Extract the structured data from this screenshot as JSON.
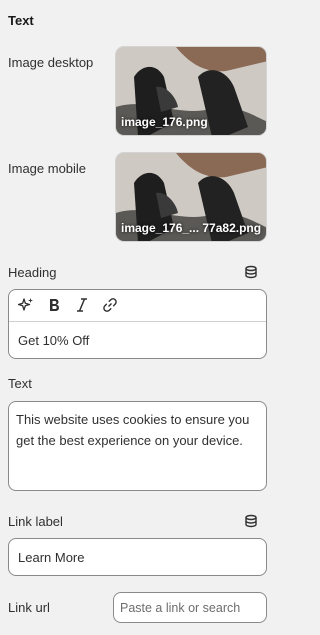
{
  "section": {
    "title": "Text"
  },
  "image_desktop": {
    "label": "Image desktop",
    "filename": "image_176.png"
  },
  "image_mobile": {
    "label": "Image mobile",
    "filename": "image_176_... 77a82.png"
  },
  "heading": {
    "label": "Heading",
    "value": "Get 10% Off",
    "toolbar": [
      "sparkle-icon",
      "bold-icon",
      "italic-icon",
      "link-icon"
    ]
  },
  "text": {
    "label": "Text",
    "value": "This website uses cookies to ensure you get the best experience on your device."
  },
  "link_label": {
    "label": "Link label",
    "value": "Learn More"
  },
  "link_url": {
    "label": "Link url",
    "placeholder": "Paste a link or search"
  },
  "colors": {
    "background": "#f1f1f1",
    "border": "#8a8a8a",
    "text": "#303030"
  }
}
